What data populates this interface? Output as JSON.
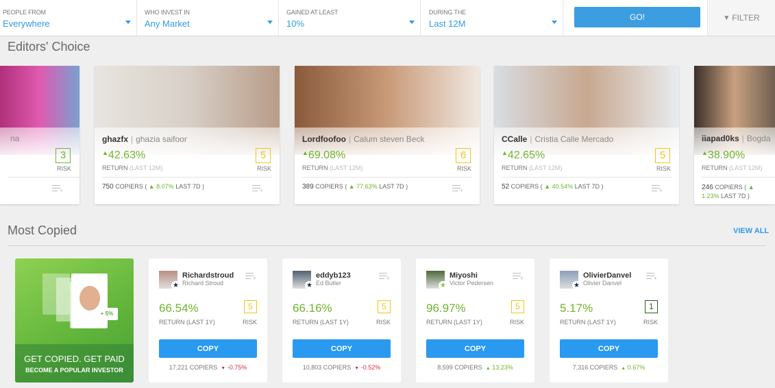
{
  "filters": [
    {
      "label": "PEOPLE FROM",
      "value": "Everywhere"
    },
    {
      "label": "WHO INVEST IN",
      "value": "Any Market"
    },
    {
      "label": "GAINED AT LEAST",
      "value": "10%"
    },
    {
      "label": "DURING THE",
      "value": "Last 12M"
    }
  ],
  "go_label": "GO!",
  "filter_label": "FILTER",
  "editors": {
    "title": "Editors' Choice",
    "return_label": "RETURN",
    "return_period": "(LAST 12M)",
    "risk_label": "RISK",
    "copiers_word": "COPIERS",
    "last7": "LAST 7D",
    "cards": [
      {
        "username": "",
        "fullname": "na",
        "return": "",
        "risk": "3",
        "riskColor": "#6fb52c",
        "copiers": "",
        "change": "",
        "photo": [
          "#b0307a",
          "#e05ab0",
          "#7aa0d0"
        ]
      },
      {
        "username": "ghazfx",
        "fullname": "ghazia saifoor",
        "return": "42.63%",
        "risk": "5",
        "riskColor": "#f0c419",
        "copiers": "750",
        "change": "8.07%",
        "photo": [
          "#e8e4df",
          "#d8d0c8",
          "#b89c88"
        ]
      },
      {
        "username": "Lordfoofoo",
        "fullname": "Calum steven Beck",
        "return": "69.08%",
        "risk": "6",
        "riskColor": "#f0c419",
        "copiers": "389",
        "change": "77.63%",
        "photo": [
          "#8a5a3c",
          "#c89a78",
          "#f0e8e0"
        ]
      },
      {
        "username": "CCalle",
        "fullname": "Cristia Calle Mercado",
        "return": "42.65%",
        "risk": "5",
        "riskColor": "#f0c419",
        "copiers": "52",
        "change": "40.54%",
        "photo": [
          "#d8dde2",
          "#c8a890",
          "#e8ecef"
        ]
      },
      {
        "username": "iiapad0ks",
        "fullname": "Bogda",
        "return": "38.90%",
        "risk": "",
        "riskColor": "#f0c419",
        "copiers": "246",
        "change": "1.23%",
        "photo": [
          "#3a3028",
          "#c8a080",
          "#706050"
        ]
      }
    ]
  },
  "most_copied": {
    "title": "Most Copied",
    "view_all": "VIEW ALL",
    "promo": {
      "line1": "GET COPIED. GET PAID",
      "line2": "BECOME A POPULAR INVESTOR",
      "badge": "+ 5%"
    },
    "return_label": "RETURN (LAST 1Y)",
    "risk_label": "RISK",
    "copy_label": "COPY",
    "copiers_word": "COPIERS",
    "cards": [
      {
        "username": "Richardstroud",
        "fullname": "Richard Stroud",
        "return": "66.54%",
        "risk": "5",
        "riskColor": "#f0c419",
        "copiers": "17,221",
        "change": "-0.75%",
        "direction": "down",
        "star": "#1d2b44",
        "avatar": "#b89080"
      },
      {
        "username": "eddyb123",
        "fullname": "Ed Butler",
        "return": "66.16%",
        "risk": "5",
        "riskColor": "#f0c419",
        "copiers": "10,803",
        "change": "-0.52%",
        "direction": "down",
        "star": "#1d2b44",
        "avatar": "#506070"
      },
      {
        "username": "Miyoshi",
        "fullname": "Victor Pedersen",
        "return": "96.97%",
        "risk": "5",
        "riskColor": "#f0c419",
        "copiers": "8,599",
        "change": "13.23%",
        "direction": "up",
        "star": "#8cc63f",
        "avatar": "#4a6a3a"
      },
      {
        "username": "OlivierDanvel",
        "fullname": "Olivier Danvel",
        "return": "5.17%",
        "risk": "1",
        "riskColor": "#2d5a1e",
        "copiers": "7,316",
        "change": "0.67%",
        "direction": "up",
        "star": "#1d2b44",
        "avatar": "#8aa0b8"
      }
    ]
  }
}
